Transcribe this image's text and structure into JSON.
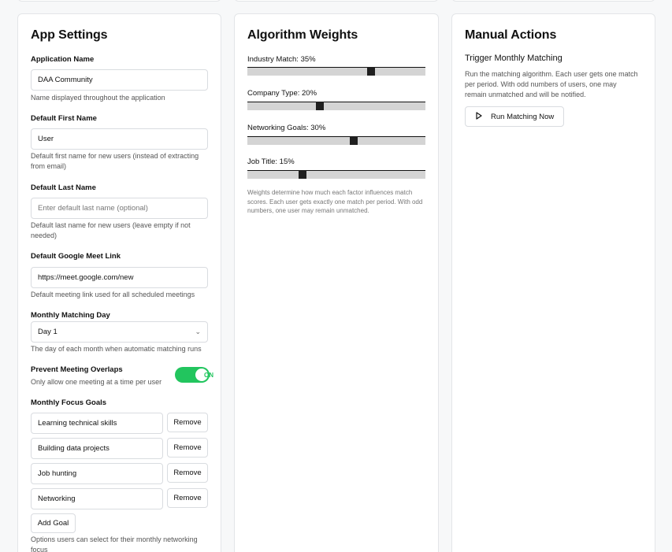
{
  "app_settings": {
    "title": "App Settings",
    "app_name": {
      "label": "Application Name",
      "value": "DAA Community",
      "help": "Name displayed throughout the application"
    },
    "first_name": {
      "label": "Default First Name",
      "value": "User",
      "help_line1": "Default first name for new users (instead of extracting",
      "help_line2": "from email)"
    },
    "last_name": {
      "label": "Default Last Name",
      "placeholder": "Enter default last name (optional)",
      "help_line1": "Default last name for new users (leave empty if not",
      "help_line2": "needed)"
    },
    "meet_link": {
      "label": "Default Google Meet Link",
      "value": "https://meet.google.com/new",
      "help": "Default meeting link used for all scheduled meetings"
    },
    "matching_day": {
      "label": "Monthly Matching Day",
      "value": "Day 1",
      "help": "The day of each month when automatic matching runs"
    },
    "overlaps": {
      "label": "Prevent Meeting Overlaps",
      "help": "Only allow one meeting at a time per user",
      "toggle_text": "ON"
    },
    "focus_goals": {
      "label": "Monthly Focus Goals",
      "remove_label": "Remove",
      "goals": [
        "Learning technical skills",
        "Building data projects",
        "Job hunting",
        "Networking"
      ],
      "add_label": "Add Goal",
      "help_line1": "Options users can select for their monthly networking",
      "help_line2": "focus"
    }
  },
  "algorithm": {
    "title": "Algorithm Weights",
    "weights": [
      {
        "label": "Industry Match: 35%",
        "value": 35
      },
      {
        "label": "Company Type: 20%",
        "value": 20
      },
      {
        "label": "Networking Goals: 30%",
        "value": 30
      },
      {
        "label": "Job Title: 15%",
        "value": 15
      }
    ],
    "note_line1": "Weights determine how much each factor influences match",
    "note_line2": "scores. Each user gets exactly one match per period. With odd",
    "note_line3": "numbers, one user may remain unmatched."
  },
  "manual": {
    "title": "Manual Actions",
    "subtitle": "Trigger Monthly Matching",
    "desc_line1": "Run the matching algorithm. Each user gets one match",
    "desc_line2": "per period. With odd numbers of users, one may",
    "desc_line3": "remain unmatched and will be notified.",
    "run_label": "Run Matching Now",
    "icon": "play-icon"
  },
  "colors": {
    "toggle_on": "#22c55e",
    "track": "#d4d4d4",
    "thumb": "#1f1f1f"
  }
}
